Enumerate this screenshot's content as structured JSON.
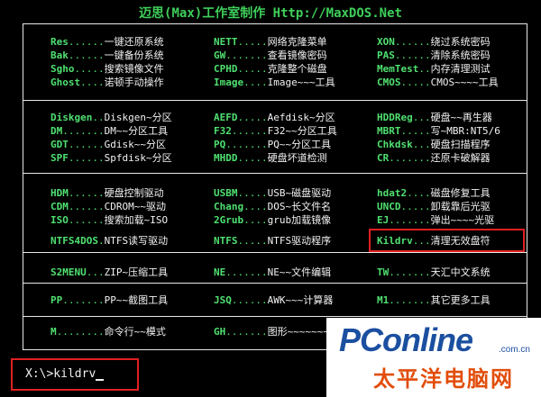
{
  "title": "迈思(Max)工作室制作 Http://MaxDOS.Net",
  "col1": [
    {
      "key": "Res",
      "dots": "......",
      "desc": "一键还原系统"
    },
    {
      "key": "Bak",
      "dots": "......",
      "desc": "一键备份系统"
    },
    {
      "key": "Sgho",
      "dots": ".....",
      "desc": "搜索镜像文件"
    },
    {
      "key": "Ghost",
      "dots": "....",
      "desc": "诺顿手动操作"
    },
    {
      "key": "Diskgen",
      "dots": "..",
      "desc": "Diskgen~分区"
    },
    {
      "key": "DM",
      "dots": ".......",
      "desc": "DM~~分区工具"
    },
    {
      "key": "GDT",
      "dots": "......",
      "desc": "Gdisk~~分区"
    },
    {
      "key": "SPF",
      "dots": "......",
      "desc": "Spfdisk~分区"
    },
    {
      "key": "HDM",
      "dots": "......",
      "desc": "硬盘控制驱动"
    },
    {
      "key": "CDM",
      "dots": "......",
      "desc": "CDROM~~驱动"
    },
    {
      "key": "ISO",
      "dots": "......",
      "desc": "搜索加载~ISO"
    },
    {
      "key": "NTFS4DOS",
      "dots": ".",
      "desc": "NTFS读写驱动"
    },
    {
      "key": "S2MENU",
      "dots": "...",
      "desc": "ZIP~压缩工具"
    },
    {
      "key": "PP",
      "dots": ".......",
      "desc": "PP~~截图工具"
    },
    {
      "key": "M",
      "dots": "........",
      "desc": "命令行~~模式"
    }
  ],
  "col2": [
    {
      "key": "NETT",
      "dots": ".....",
      "desc": "网络克隆菜单"
    },
    {
      "key": "GW",
      "dots": ".......",
      "desc": "查看镜像密码"
    },
    {
      "key": "CPHD",
      "dots": ".....",
      "desc": "克隆整个磁盘"
    },
    {
      "key": "Image",
      "dots": "....",
      "desc": "Image~~~工具"
    },
    {
      "key": "AEFD",
      "dots": ".....",
      "desc": "Aefdisk~分区"
    },
    {
      "key": "F32",
      "dots": "......",
      "desc": "F32~~分区工具"
    },
    {
      "key": "PQ",
      "dots": ".......",
      "desc": "PQ~~分区工具"
    },
    {
      "key": "MHDD",
      "dots": ".....",
      "desc": "硬盘坏道检测"
    },
    {
      "key": "USBM",
      "dots": ".....",
      "desc": "USB~磁盘驱动"
    },
    {
      "key": "Chang",
      "dots": "....",
      "desc": "DOS~长文件名"
    },
    {
      "key": "2Grub",
      "dots": "....",
      "desc": "grub加载镜像"
    },
    {
      "key": "NTFS",
      "dots": ".....",
      "desc": "NTFS驱动程序"
    },
    {
      "key": "NE",
      "dots": ".......",
      "desc": "NE~~文件编辑"
    },
    {
      "key": "JSQ",
      "dots": "......",
      "desc": "AWK~~~计算器"
    },
    {
      "key": "GH",
      "dots": ".......",
      "desc": "图形~~~~~~~~"
    }
  ],
  "col3": [
    {
      "key": "XON",
      "dots": "......",
      "desc": "绕过系统密码"
    },
    {
      "key": "PAS",
      "dots": "......",
      "desc": "清除系统密码"
    },
    {
      "key": "MemTest",
      "dots": "..",
      "desc": "内存清理测试"
    },
    {
      "key": "CMOS",
      "dots": ".....",
      "desc": "CMOS~~~~工具"
    },
    {
      "key": "HDDReg",
      "dots": "...",
      "desc": "硬盘~~再生器"
    },
    {
      "key": "MBRT",
      "dots": ".....",
      "desc": "写~MBR:NT5/6"
    },
    {
      "key": "Chkdsk",
      "dots": "...",
      "desc": "硬盘扫描程序"
    },
    {
      "key": "CR",
      "dots": ".......",
      "desc": "还原卡破解器"
    },
    {
      "key": "hdat2",
      "dots": "....",
      "desc": "磁盘修复工具"
    },
    {
      "key": "UNCD",
      "dots": ".....",
      "desc": "卸载靠后光驱"
    },
    {
      "key": "EJ",
      "dots": ".......",
      "desc": "弹出~~~~光驱"
    },
    {
      "key": "Kildrv",
      "dots": "...",
      "desc": "清理无效盘符"
    },
    {
      "key": "TW",
      "dots": ".......",
      "desc": "天汇中文系统"
    },
    {
      "key": "M1",
      "dots": ".......",
      "desc": "其它更多工具"
    },
    {
      "key": "",
      "dots": "",
      "desc": ""
    }
  ],
  "prompt": {
    "text": "X:\\>kildrv"
  },
  "watermark": {
    "logo": "PConline",
    "domain": ".com.cn",
    "cn": "太平洋电脑网"
  },
  "colors": {
    "key": "#4fe070",
    "desc": "#f2f2f2",
    "title": "#3ecf5a",
    "highlight": "#e02020"
  }
}
